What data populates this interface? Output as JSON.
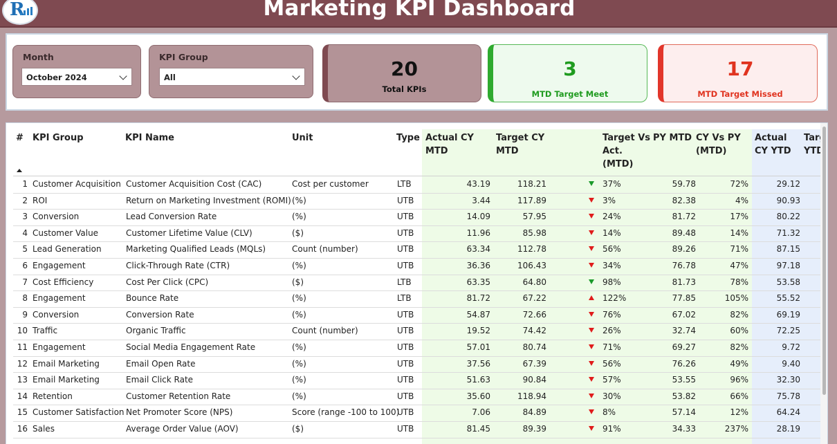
{
  "header": {
    "title": "Marketing KPI Dashboard",
    "logo_icon": "company-logo-icon",
    "colors": {
      "header_bg": "#7f4a51",
      "page_bg": "#b69a9e"
    }
  },
  "filters": {
    "month": {
      "label": "Month",
      "value": "October 2024"
    },
    "kpi_group": {
      "label": "KPI Group",
      "value": "All"
    }
  },
  "cards": {
    "total": {
      "value": "20",
      "label": "Total KPIs"
    },
    "meet": {
      "value": "3",
      "label": "MTD Target Meet",
      "color": "#1f9b1f"
    },
    "missed": {
      "value": "17",
      "label": "MTD Target Missed",
      "color": "#e0331f"
    }
  },
  "table": {
    "headers": {
      "num": "#",
      "kpi_group": "KPI Group",
      "kpi_name": "KPI Name",
      "unit": "Unit",
      "type": "Type",
      "actual_mtd": [
        "Actual CY",
        "MTD"
      ],
      "target_mtd": [
        "Target CY",
        "MTD"
      ],
      "tvsa_mtd": [
        "Target Vs",
        "Act.",
        "(MTD)"
      ],
      "py_mtd": "PY MTD",
      "cy_vs_py": [
        "CY Vs PY",
        "(MTD)"
      ],
      "actual_ytd": [
        "Actual",
        "CY YTD"
      ],
      "target_ytd": [
        "Targ",
        "YTD"
      ]
    },
    "rows": [
      {
        "n": "1",
        "group": "Customer Acquisition",
        "name": "Customer Acquisition Cost (CAC)",
        "unit": "Cost per customer",
        "type": "LTB",
        "actual": "43.19",
        "target": "118.21",
        "trend": "down-good",
        "tvsa": "37%",
        "py": "59.78",
        "cyvspy": "72%",
        "ytd": "29.12"
      },
      {
        "n": "2",
        "group": "ROI",
        "name": "Return on Marketing Investment (ROMI)",
        "unit": " (%)",
        "type": "UTB",
        "actual": "3.44",
        "target": "117.89",
        "trend": "down",
        "tvsa": "3%",
        "py": "82.38",
        "cyvspy": "4%",
        "ytd": "90.93"
      },
      {
        "n": "3",
        "group": "Conversion",
        "name": "Lead Conversion Rate",
        "unit": " (%)",
        "type": "UTB",
        "actual": "14.09",
        "target": "57.95",
        "trend": "down",
        "tvsa": "24%",
        "py": "81.72",
        "cyvspy": "17%",
        "ytd": "80.22"
      },
      {
        "n": "4",
        "group": "Customer Value",
        "name": "Customer Lifetime Value (CLV)",
        "unit": " ($)",
        "type": "UTB",
        "actual": "11.96",
        "target": "85.98",
        "trend": "down",
        "tvsa": "14%",
        "py": "89.48",
        "cyvspy": "14%",
        "ytd": "71.32"
      },
      {
        "n": "5",
        "group": "Lead Generation",
        "name": "Marketing Qualified Leads (MQLs)",
        "unit": "Count (number)",
        "type": "UTB",
        "actual": "63.34",
        "target": "112.78",
        "trend": "down",
        "tvsa": "56%",
        "py": "89.26",
        "cyvspy": "71%",
        "ytd": "87.15"
      },
      {
        "n": "6",
        "group": "Engagement",
        "name": "Click-Through Rate (CTR)",
        "unit": " (%)",
        "type": "UTB",
        "actual": "36.36",
        "target": "106.43",
        "trend": "down",
        "tvsa": "34%",
        "py": "76.78",
        "cyvspy": "47%",
        "ytd": "97.18"
      },
      {
        "n": "7",
        "group": "Cost Efficiency",
        "name": "Cost Per Click (CPC)",
        "unit": " ($)",
        "type": "LTB",
        "actual": "63.35",
        "target": "64.80",
        "trend": "down-good",
        "tvsa": "98%",
        "py": "81.73",
        "cyvspy": "78%",
        "ytd": "53.58"
      },
      {
        "n": "8",
        "group": "Engagement",
        "name": "Bounce Rate",
        "unit": "(%)",
        "type": "LTB",
        "actual": "81.72",
        "target": "67.22",
        "trend": "up",
        "tvsa": "122%",
        "py": "77.85",
        "cyvspy": "105%",
        "ytd": "55.52"
      },
      {
        "n": "9",
        "group": "Conversion",
        "name": "Conversion Rate",
        "unit": "(%)",
        "type": "UTB",
        "actual": "54.87",
        "target": "72.66",
        "trend": "down",
        "tvsa": "76%",
        "py": "67.02",
        "cyvspy": "82%",
        "ytd": "69.19"
      },
      {
        "n": "10",
        "group": "Traffic",
        "name": "Organic Traffic",
        "unit": "Count (number)",
        "type": "UTB",
        "actual": "19.52",
        "target": "74.42",
        "trend": "down",
        "tvsa": "26%",
        "py": "32.74",
        "cyvspy": "60%",
        "ytd": "72.25"
      },
      {
        "n": "11",
        "group": "Engagement",
        "name": "Social Media Engagement Rate",
        "unit": " (%)",
        "type": "UTB",
        "actual": "57.01",
        "target": "80.74",
        "trend": "down",
        "tvsa": "71%",
        "py": "69.27",
        "cyvspy": "82%",
        "ytd": "9.72"
      },
      {
        "n": "12",
        "group": "Email Marketing",
        "name": "Email Open Rate",
        "unit": " (%)",
        "type": "UTB",
        "actual": "37.56",
        "target": "67.39",
        "trend": "down",
        "tvsa": "56%",
        "py": "76.26",
        "cyvspy": "49%",
        "ytd": "9.40"
      },
      {
        "n": "13",
        "group": "Email Marketing",
        "name": "Email Click Rate",
        "unit": " (%)",
        "type": "UTB",
        "actual": "51.63",
        "target": "90.84",
        "trend": "down",
        "tvsa": "57%",
        "py": "53.55",
        "cyvspy": "96%",
        "ytd": "32.30"
      },
      {
        "n": "14",
        "group": "Retention",
        "name": "Customer Retention Rate",
        "unit": " (%)",
        "type": "UTB",
        "actual": "35.60",
        "target": "118.94",
        "trend": "down",
        "tvsa": "30%",
        "py": "53.82",
        "cyvspy": "66%",
        "ytd": "75.78"
      },
      {
        "n": "15",
        "group": "Customer Satisfaction",
        "name": "Net Promoter Score (NPS)",
        "unit": "Score (range -100 to 100)",
        "type": "UTB",
        "actual": "7.06",
        "target": "84.89",
        "trend": "down",
        "tvsa": "8%",
        "py": "57.14",
        "cyvspy": "12%",
        "ytd": "64.24"
      },
      {
        "n": "16",
        "group": "Sales",
        "name": "Average Order Value (AOV)",
        "unit": " ($)",
        "type": "UTB",
        "actual": "81.45",
        "target": "89.39",
        "trend": "down",
        "tvsa": "91%",
        "py": "34.33",
        "cyvspy": "237%",
        "ytd": "28.19"
      }
    ]
  }
}
